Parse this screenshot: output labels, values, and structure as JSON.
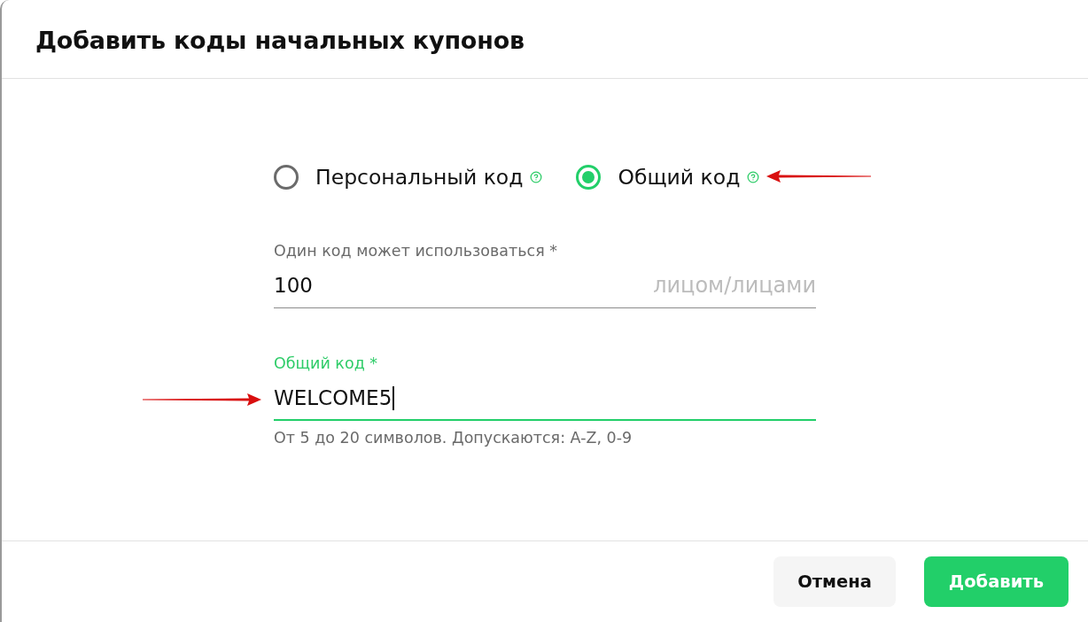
{
  "dialog": {
    "title": "Добавить коды начальных купонов"
  },
  "code_type": {
    "options": [
      {
        "label": "Персональный код",
        "selected": false,
        "arrow_annotation": false
      },
      {
        "label": "Общий код",
        "selected": true,
        "arrow_annotation": true
      }
    ]
  },
  "fields": [
    {
      "label": "Один код может использоваться *",
      "value": "100",
      "suffix": "лицом/лицами",
      "focused": false,
      "arrow_annotation": false
    },
    {
      "label": "Общий код *",
      "value": "WELCOME5",
      "focused": true,
      "hint": "От 5 до 20 символов. Допускаются: A-Z, 0-9",
      "arrow_annotation": true
    }
  ],
  "buttons": [
    {
      "label": "Отмена",
      "kind": "secondary"
    },
    {
      "label": "Добавить",
      "kind": "primary"
    }
  ]
}
